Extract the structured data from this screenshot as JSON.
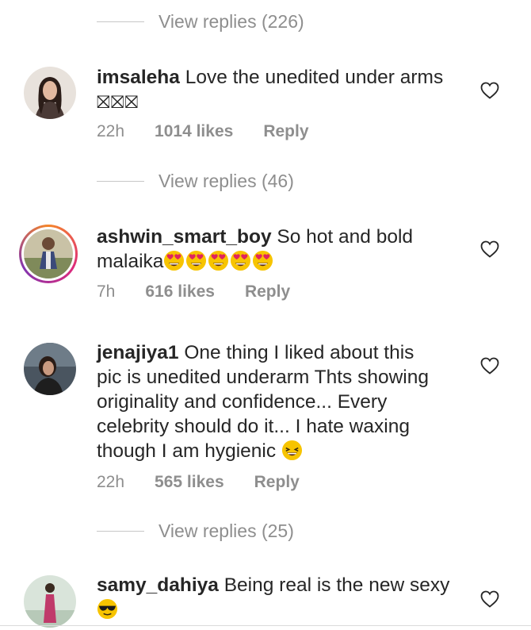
{
  "thread": [
    {
      "type": "view_replies",
      "label": "View replies (226)"
    },
    {
      "type": "comment",
      "username": "imsaleha",
      "text": "Love the unedited under arms",
      "text_line2": "⛝⛝⛝",
      "time": "22h",
      "likes": "1014 likes",
      "reply": "Reply",
      "avatar_icon": "user-avatar"
    },
    {
      "type": "view_replies",
      "label": "View replies (46)"
    },
    {
      "type": "comment",
      "username": "ashwin_smart_boy",
      "text": "So hot and bold",
      "text_line2": "malaika",
      "emojis": [
        "heart-eyes-emoji",
        "heart-eyes-emoji",
        "heart-eyes-emoji",
        "heart-eyes-emoji",
        "heart-eyes-emoji"
      ],
      "time": "7h",
      "likes": "616 likes",
      "reply": "Reply",
      "avatar_icon": "user-avatar-story-ring"
    },
    {
      "type": "comment",
      "username": "jenajiya1",
      "text": "One thing I liked about this",
      "lines": [
        "pic is unedited underarm Thts showing",
        "originality and confidence... Every",
        "celebrity should do it... I hate waxing",
        "though I am hygienic"
      ],
      "emoji": "grinning-squint-emoji",
      "time": "22h",
      "likes": "565 likes",
      "reply": "Reply",
      "avatar_icon": "user-avatar"
    },
    {
      "type": "view_replies",
      "label": "View replies (25)"
    },
    {
      "type": "comment",
      "username": "samy_dahiya",
      "text": "Being real is the new sexy",
      "emoji": "sunglasses-emoji",
      "avatar_icon": "user-avatar"
    }
  ],
  "icons": {
    "like": "heart-outline-icon"
  },
  "colors": {
    "text": "#262626",
    "muted": "#8e8e8e",
    "emoji_yellow": "#f7c400",
    "heart_eyes": "#e0245e"
  }
}
